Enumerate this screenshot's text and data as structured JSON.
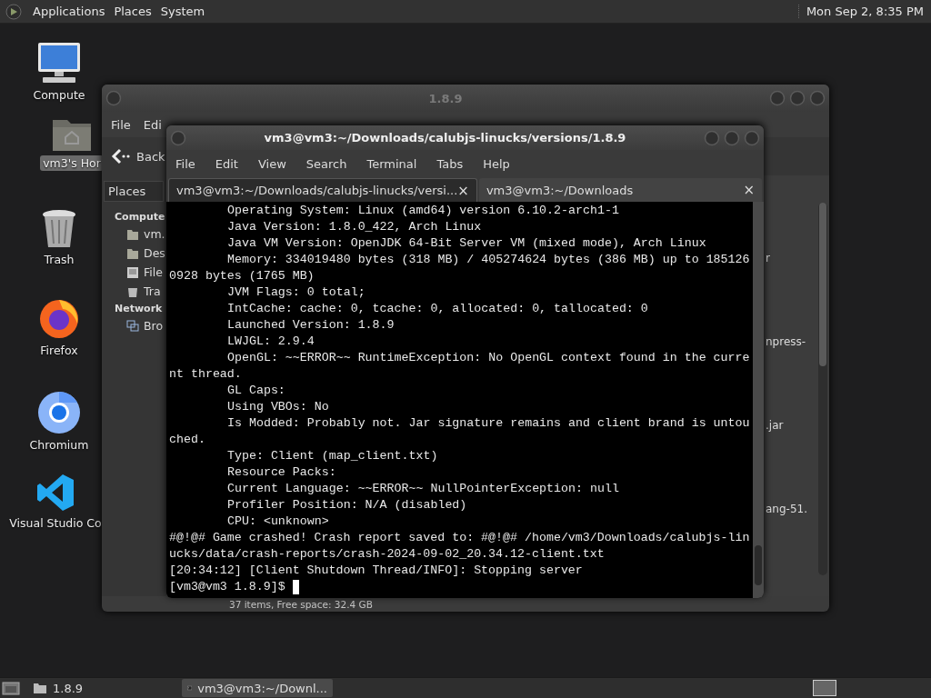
{
  "top_panel": {
    "menus": [
      "Applications",
      "Places",
      "System"
    ],
    "clock": "Mon Sep  2,  8:35 PM"
  },
  "desktop_icons": [
    {
      "kind": "computer",
      "label": "Compute",
      "selected": false
    },
    {
      "kind": "home",
      "label": "vm3's Hor",
      "selected": true
    },
    {
      "kind": "trash",
      "label": "Trash",
      "selected": false
    },
    {
      "kind": "firefox",
      "label": "Firefox",
      "selected": false
    },
    {
      "kind": "chromium",
      "label": "Chromium",
      "selected": false
    },
    {
      "kind": "vscode",
      "label": "Visual Studio Co",
      "selected": false
    }
  ],
  "file_manager": {
    "title": "1.8.9",
    "menu": [
      "File",
      "Edi"
    ],
    "back": "Back",
    "places": "Places",
    "sidebar": [
      {
        "label": "Compute",
        "kind": "heading"
      },
      {
        "label": "vm.",
        "kind": "home"
      },
      {
        "label": "Des",
        "kind": "desktop"
      },
      {
        "label": "File",
        "kind": "drive"
      },
      {
        "label": "Tra",
        "kind": "trash"
      },
      {
        "label": "Network",
        "kind": "heading"
      },
      {
        "label": "Bro",
        "kind": "network"
      }
    ],
    "files": [
      "r",
      "npress-",
      ".jar",
      "ang-51."
    ],
    "status": "37 items, Free space: 32.4 GB"
  },
  "terminal": {
    "title": "vm3@vm3:~/Downloads/calubjs-linucks/versions/1.8.9",
    "menu": [
      "File",
      "Edit",
      "View",
      "Search",
      "Terminal",
      "Tabs",
      "Help"
    ],
    "tabs": [
      {
        "label": "vm3@vm3:~/Downloads/calubjs-linucks/versi...",
        "close": "×",
        "selected": true
      },
      {
        "label": "vm3@vm3:~/Downloads",
        "close": "×",
        "selected": false
      }
    ],
    "lines": [
      {
        "text": "Operating System: Linux (amd64) version 6.10.2-arch1-1",
        "indented": true
      },
      {
        "text": "Java Version: 1.8.0_422, Arch Linux",
        "indented": true
      },
      {
        "text": "Java VM Version: OpenJDK 64-Bit Server VM (mixed mode), Arch Linux",
        "indented": true
      },
      {
        "text": "Memory: 334019480 bytes (318 MB) / 405274624 bytes (386 MB) up to 185126",
        "indented": true
      },
      {
        "text": "0928 bytes (1765 MB)",
        "indented": false
      },
      {
        "text": "JVM Flags: 0 total;",
        "indented": true
      },
      {
        "text": "IntCache: cache: 0, tcache: 0, allocated: 0, tallocated: 0",
        "indented": true
      },
      {
        "text": "Launched Version: 1.8.9",
        "indented": true
      },
      {
        "text": "LWJGL: 2.9.4",
        "indented": true
      },
      {
        "text": "OpenGL: ~~ERROR~~ RuntimeException: No OpenGL context found in the curre",
        "indented": true
      },
      {
        "text": "nt thread.",
        "indented": false
      },
      {
        "text": "GL Caps:",
        "indented": true
      },
      {
        "text": "Using VBOs: No",
        "indented": true
      },
      {
        "text": "Is Modded: Probably not. Jar signature remains and client brand is untou",
        "indented": true
      },
      {
        "text": "ched.",
        "indented": false
      },
      {
        "text": "Type: Client (map_client.txt)",
        "indented": true
      },
      {
        "text": "Resource Packs:",
        "indented": true
      },
      {
        "text": "Current Language: ~~ERROR~~ NullPointerException: null",
        "indented": true
      },
      {
        "text": "Profiler Position: N/A (disabled)",
        "indented": true
      },
      {
        "text": "CPU: <unknown>",
        "indented": true
      },
      {
        "text": "#@!@# Game crashed! Crash report saved to: #@!@# /home/vm3/Downloads/calubjs-lin",
        "indented": false
      },
      {
        "text": "ucks/data/crash-reports/crash-2024-09-02_20.34.12-client.txt",
        "indented": false
      },
      {
        "text": "[20:34:12] [Client Shutdown Thread/INFO]: Stopping server",
        "indented": false
      }
    ],
    "prompt": "[vm3@vm3 1.8.9]$"
  },
  "taskbar": {
    "items": [
      {
        "label": "1.8.9",
        "kind": "folder",
        "selected": false
      },
      {
        "label": "vm3@vm3:~/Downl...",
        "kind": "terminal",
        "selected": true
      }
    ]
  }
}
